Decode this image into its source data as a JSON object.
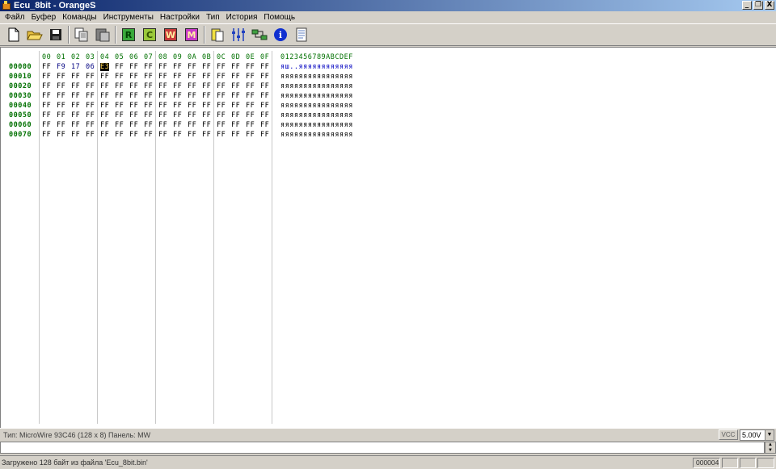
{
  "window": {
    "title": "Ecu_8bit - OrangeS"
  },
  "title_buttons": {
    "minimize": "_",
    "restore": "❐",
    "close": "X"
  },
  "menu": [
    "Файл",
    "Буфер",
    "Команды",
    "Инструменты",
    "Настройки",
    "Тип",
    "История",
    "Помощь"
  ],
  "toolbar": {
    "icons": [
      "new-file-icon",
      "open-folder-icon",
      "save-disk-icon",
      "copy-icon",
      "paste-icon",
      "read-chip-icon",
      "compare-chip-icon",
      "write-chip-icon",
      "misc-chip-icon",
      "clipboard-icon",
      "settings-sliders-icon",
      "connection-icon",
      "info-icon",
      "notes-icon"
    ],
    "chip_letters": {
      "read": "R",
      "compare": "C",
      "write": "W",
      "misc": "M"
    },
    "info_letter": "i",
    "colors": {
      "read": "#3aa83a",
      "compare": "#9ac83a",
      "write": "#c83a3a",
      "misc": "#c83ac8"
    }
  },
  "hex": {
    "columns": [
      "00",
      "01",
      "02",
      "03",
      "04",
      "05",
      "06",
      "07",
      "08",
      "09",
      "0A",
      "0B",
      "0C",
      "0D",
      "0E",
      "0F"
    ],
    "ascii_header": "0123456789ABCDEF",
    "rows": [
      {
        "addr": "00000",
        "bytes": [
          "FF",
          "F9",
          "17",
          "06",
          "E3",
          "FF",
          "FF",
          "FF",
          "FF",
          "FF",
          "FF",
          "FF",
          "FF",
          "FF",
          "FF",
          "FF"
        ],
        "ascii": "яш..яяяяяяяяяяяя"
      },
      {
        "addr": "00010",
        "bytes": [
          "FF",
          "FF",
          "FF",
          "FF",
          "FF",
          "FF",
          "FF",
          "FF",
          "FF",
          "FF",
          "FF",
          "FF",
          "FF",
          "FF",
          "FF",
          "FF"
        ],
        "ascii": "яяяяяяяяяяяяяяяя"
      },
      {
        "addr": "00020",
        "bytes": [
          "FF",
          "FF",
          "FF",
          "FF",
          "FF",
          "FF",
          "FF",
          "FF",
          "FF",
          "FF",
          "FF",
          "FF",
          "FF",
          "FF",
          "FF",
          "FF"
        ],
        "ascii": "яяяяяяяяяяяяяяяя"
      },
      {
        "addr": "00030",
        "bytes": [
          "FF",
          "FF",
          "FF",
          "FF",
          "FF",
          "FF",
          "FF",
          "FF",
          "FF",
          "FF",
          "FF",
          "FF",
          "FF",
          "FF",
          "FF",
          "FF"
        ],
        "ascii": "яяяяяяяяяяяяяяяя"
      },
      {
        "addr": "00040",
        "bytes": [
          "FF",
          "FF",
          "FF",
          "FF",
          "FF",
          "FF",
          "FF",
          "FF",
          "FF",
          "FF",
          "FF",
          "FF",
          "FF",
          "FF",
          "FF",
          "FF"
        ],
        "ascii": "яяяяяяяяяяяяяяяя"
      },
      {
        "addr": "00050",
        "bytes": [
          "FF",
          "FF",
          "FF",
          "FF",
          "FF",
          "FF",
          "FF",
          "FF",
          "FF",
          "FF",
          "FF",
          "FF",
          "FF",
          "FF",
          "FF",
          "FF"
        ],
        "ascii": "яяяяяяяяяяяяяяяя"
      },
      {
        "addr": "00060",
        "bytes": [
          "FF",
          "FF",
          "FF",
          "FF",
          "FF",
          "FF",
          "FF",
          "FF",
          "FF",
          "FF",
          "FF",
          "FF",
          "FF",
          "FF",
          "FF",
          "FF"
        ],
        "ascii": "яяяяяяяяяяяяяяяя"
      },
      {
        "addr": "00070",
        "bytes": [
          "FF",
          "FF",
          "FF",
          "FF",
          "FF",
          "FF",
          "FF",
          "FF",
          "FF",
          "FF",
          "FF",
          "FF",
          "FF",
          "FF",
          "FF",
          "FF"
        ],
        "ascii": "яяяяяяяяяяяяяяяя"
      }
    ],
    "cursor": {
      "row": 0,
      "col": 4
    },
    "colors": {
      "address": "#007000",
      "header": "#007000",
      "edited_byte": "#000080",
      "ascii_highlight": "#0000c0"
    }
  },
  "info": {
    "text": "Тип: MicroWire 93C46 (128 x 8)  Панель: MW",
    "vcc_label": "VCC",
    "voltage": "5.00V"
  },
  "status": {
    "message": "Загружено 128  байт из файла 'Ecu_8bit.bin'",
    "offset": "000004"
  }
}
